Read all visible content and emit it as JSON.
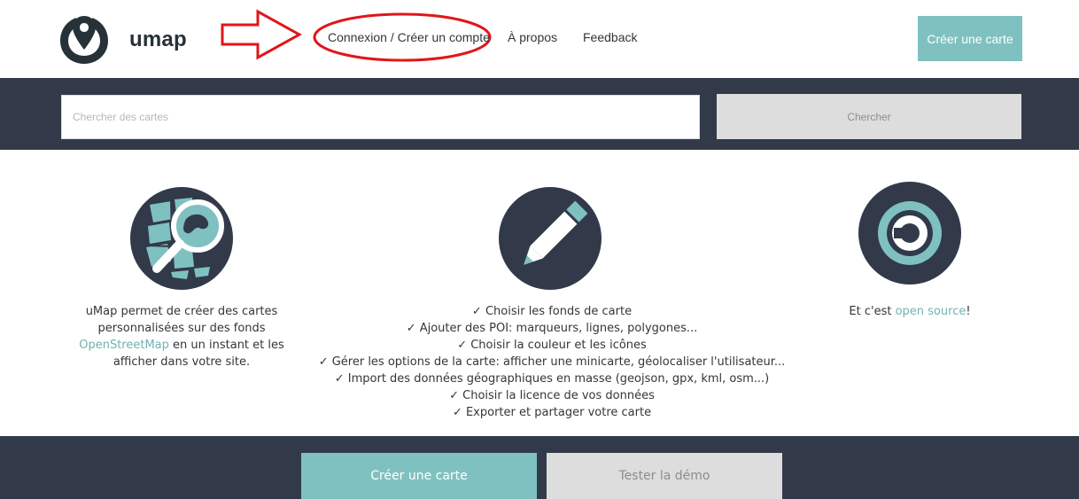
{
  "header": {
    "brand": "umap",
    "nav": {
      "login": "Connexion / Créer un compte",
      "about": "À propos",
      "feedback": "Feedback"
    },
    "create_map": "Créer une carte"
  },
  "search": {
    "placeholder": "Chercher des cartes",
    "button": "Chercher"
  },
  "features": {
    "intro": {
      "before": "uMap permet de créer des cartes personnalisées sur des fonds ",
      "link": "OpenStreetMap",
      "after": " en un instant et les afficher dans votre site."
    },
    "checklist": [
      "✓ Choisir les fonds de carte",
      "✓ Ajouter des POI: marqueurs, lignes, polygones...",
      "✓ Choisir la couleur et les icônes",
      "✓ Gérer les options de la carte: afficher une minicarte, géolocaliser l'utilisateur...",
      "✓ Import des données géographiques en masse (geojson, gpx, kml, osm...)",
      "✓ Choisir la licence de vos données",
      "✓ Exporter et partager votre carte"
    ],
    "opensource": {
      "before": "Et c'est ",
      "link": "open source",
      "after": "!"
    }
  },
  "bottom": {
    "create_map": "Créer une carte",
    "demo": "Tester la démo"
  },
  "icons": {
    "logo": "location-pin-icon",
    "arrow": "red-arrow-annotation",
    "highlight": "red-ellipse-annotation",
    "explore": "map-magnifier-icon",
    "edit": "pencil-icon",
    "copyleft": "copyleft-icon"
  },
  "colors": {
    "dark": "#323a4a",
    "accent": "#7fc1c0",
    "link": "#6fb3b2",
    "gray_button": "#dddddd",
    "annotation": "#e0161b"
  }
}
